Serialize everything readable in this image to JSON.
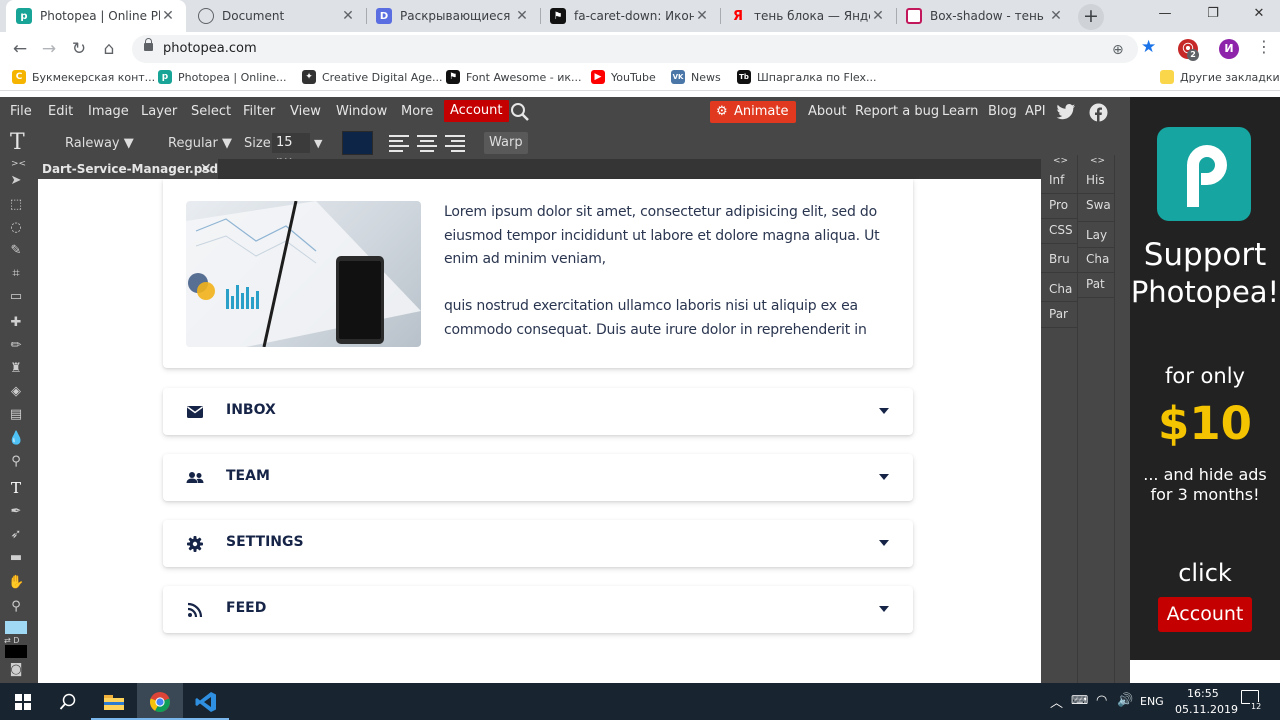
{
  "browser": {
    "tabs": [
      {
        "title": "Photopea | Online Phot",
        "favicon_color": "#18a497",
        "favicon_glyph": "p"
      },
      {
        "title": "Document",
        "favicon_color": "#5f6368",
        "favicon_glyph": "globe"
      },
      {
        "title": "Раскрывающиеся бло",
        "favicon_color": "#5b6ee1",
        "favicon_glyph": "D"
      },
      {
        "title": "fa-caret-down: Иконки",
        "favicon_color": "#111111",
        "favicon_glyph": "flag"
      },
      {
        "title": "тень блока — Яндекс",
        "favicon_color": "#ff0000",
        "favicon_glyph": "Я"
      },
      {
        "title": "Box-shadow - тень бло",
        "favicon_color": "#3b5998",
        "favicon_glyph": "box"
      }
    ],
    "url": "photopea.com",
    "profile_initial": "И",
    "ext_badge": "2",
    "bookmarks": [
      {
        "label": "Букмекерская конт...",
        "color": "#f4b400",
        "glyph": "C"
      },
      {
        "label": "Photopea | Online...",
        "color": "#18a497",
        "glyph": "p"
      },
      {
        "label": "Creative Digital Age...",
        "color": "#333333",
        "glyph": "✦"
      },
      {
        "label": "Font Awesome - ик...",
        "color": "#111111",
        "glyph": "⚑"
      },
      {
        "label": "YouTube",
        "color": "#ff0000",
        "glyph": "▶"
      },
      {
        "label": "News",
        "color": "#4a76a8",
        "glyph": "VK"
      },
      {
        "label": "Шпаргалка по Flex...",
        "color": "#111111",
        "glyph": "Tb"
      }
    ],
    "other_bookmarks": "Другие закладки"
  },
  "photopea": {
    "menu": [
      "File",
      "Edit",
      "Image",
      "Layer",
      "Select",
      "Filter",
      "View",
      "Window",
      "More"
    ],
    "account_label": "Account",
    "animate_label": "Animate",
    "right_menu": [
      "About",
      "Report a bug",
      "Learn",
      "Blog",
      "API"
    ],
    "options": {
      "font": "Raleway ▼",
      "weight": "Regular ▼",
      "size_label": "Size:",
      "size_value": "15 px",
      "text_color": "#0d2547",
      "warp_label": "Warp"
    },
    "document_tab": "Dart-Service-Manager.psd",
    "panels_left": [
      "Inf",
      "Pro",
      "CSS",
      "Bru",
      "Cha",
      "Par"
    ],
    "panels_right": [
      "His",
      "Swa",
      "Lay",
      "Cha",
      "Pat"
    ],
    "panel_grip": "<>"
  },
  "page": {
    "paragraph1": "Lorem ipsum dolor sit amet, consectetur adipisicing elit, sed do eiusmod tempor incididunt ut labore et dolore magna aliqua. Ut enim ad minim veniam,",
    "paragraph2": "quis nostrud exercitation ullamco laboris nisi ut aliquip ex ea commodo consequat. Duis aute irure dolor in reprehenderit in",
    "accordion": [
      {
        "label": "INBOX",
        "icon": "envelope-icon"
      },
      {
        "label": "TEAM",
        "icon": "users-icon"
      },
      {
        "label": "SETTINGS",
        "icon": "gear-icon"
      },
      {
        "label": "FEED",
        "icon": "rss-icon"
      }
    ]
  },
  "ad": {
    "line1": "Support",
    "line2": "Photopea!",
    "line3": "for only",
    "price": "$10",
    "line4": "... and hide ads",
    "line5": "for 3 months!",
    "line6": "click",
    "button": "Account"
  },
  "taskbar": {
    "lang": "ENG",
    "time": "16:55",
    "date": "05.11.2019",
    "notif_count": "12"
  },
  "colors": {
    "accent_red": "#c50000",
    "price_yellow": "#f5c400",
    "text_navy": "#162447"
  }
}
